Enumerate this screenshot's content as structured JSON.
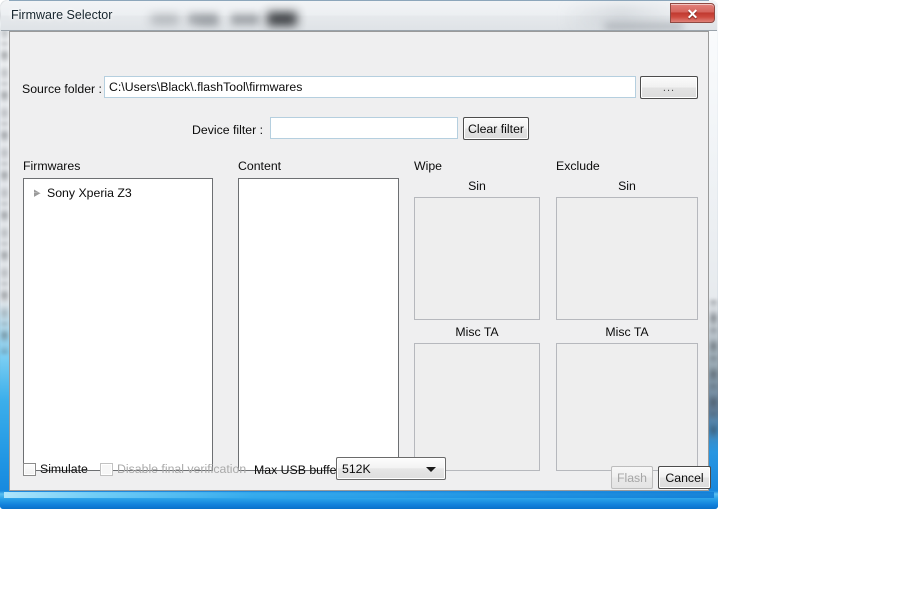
{
  "window": {
    "title": "Firmware Selector",
    "close_label": "✕",
    "close_icon": "close-icon"
  },
  "source": {
    "label": "Source folder :",
    "value": "C:\\Users\\Black\\.flashTool\\firmwares",
    "placeholder": "",
    "browse_label": "..."
  },
  "filter": {
    "label": "Device filter :",
    "value": "",
    "placeholder": "",
    "clear_label": "Clear filter"
  },
  "panels": {
    "firmwares": {
      "header": "Firmwares",
      "items": [
        {
          "label": "Sony Xperia Z3",
          "expanded": false
        }
      ]
    },
    "content": {
      "header": "Content",
      "items": []
    },
    "wipe": {
      "header": "Wipe",
      "sin_header": "Sin",
      "misc_ta_header": "Misc TA",
      "sin_items": [],
      "misc_ta_items": []
    },
    "exclude": {
      "header": "Exclude",
      "sin_header": "Sin",
      "misc_ta_header": "Misc TA",
      "sin_items": [],
      "misc_ta_items": []
    }
  },
  "options": {
    "simulate_label": "Simulate",
    "simulate_checked": false,
    "disable_verification_label": "Disable final verification",
    "disable_verification_checked": false,
    "disable_verification_enabled": false,
    "usb_buffer_label": "Max USB buffer",
    "usb_buffer_value": "512K",
    "usb_buffer_options": [
      "512K"
    ]
  },
  "actions": {
    "flash_label": "Flash",
    "flash_enabled": false,
    "cancel_label": "Cancel",
    "cancel_enabled": true
  },
  "colors": {
    "aero_border": "#1080db",
    "close_red": "#c03a30",
    "dialog_bg": "#efeff0",
    "field_bg": "#ffffff",
    "disabled_text": "#a9a9a9"
  }
}
